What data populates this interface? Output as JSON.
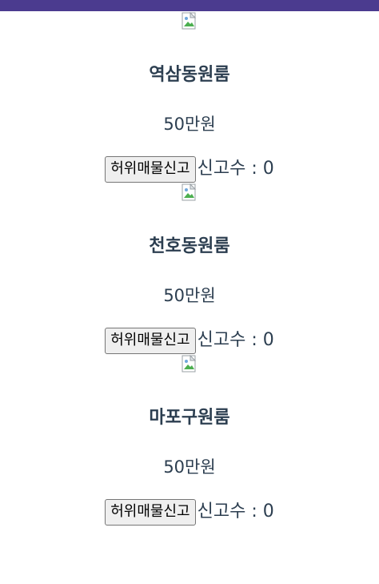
{
  "colors": {
    "topbar": "#4b3b8f",
    "text": "#2c3e50"
  },
  "listings": [
    {
      "title": "역삼동원룸",
      "price": "50만원",
      "report_button_label": "허위매물신고",
      "report_count_label": "신고수 : 0",
      "image_icon": "broken-image-icon"
    },
    {
      "title": "천호동원룸",
      "price": "50만원",
      "report_button_label": "허위매물신고",
      "report_count_label": "신고수 : 0",
      "image_icon": "broken-image-icon"
    },
    {
      "title": "마포구원룸",
      "price": "50만원",
      "report_button_label": "허위매물신고",
      "report_count_label": "신고수 : 0",
      "image_icon": "broken-image-icon"
    }
  ]
}
